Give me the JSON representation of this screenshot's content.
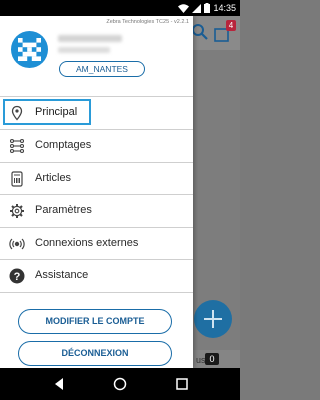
{
  "status_bar": {
    "time": "14:35"
  },
  "background": {
    "cart_badge": "4",
    "footer_text": "us",
    "footer_count": "0"
  },
  "drawer": {
    "version": "Zebra Technologies TC25 - v2.2.1",
    "site_chip": "AM_NANTES",
    "menu": [
      {
        "id": "principal",
        "label": "Principal",
        "icon": "location-pin-icon",
        "selected": true
      },
      {
        "id": "comptages",
        "label": "Comptages",
        "icon": "counts-icon",
        "selected": false
      },
      {
        "id": "articles",
        "label": "Articles",
        "icon": "barcode-label-icon",
        "selected": false
      },
      {
        "id": "parametres",
        "label": "Paramètres",
        "icon": "gear-icon",
        "selected": false
      },
      {
        "id": "connexions",
        "label": "Connexions externes",
        "icon": "broadcast-icon",
        "selected": false
      },
      {
        "id": "assistance",
        "label": "Assistance",
        "icon": "help-icon",
        "selected": false
      }
    ],
    "modify_button": "MODIFIER LE COMPTE",
    "logout_button": "DÉCONNEXION"
  },
  "colors": {
    "accent": "#1a6da8",
    "selection": "#2a9bd8",
    "avatar": "#1e8fd5",
    "badge": "#b8253c",
    "fab": "#1f6fa3"
  }
}
